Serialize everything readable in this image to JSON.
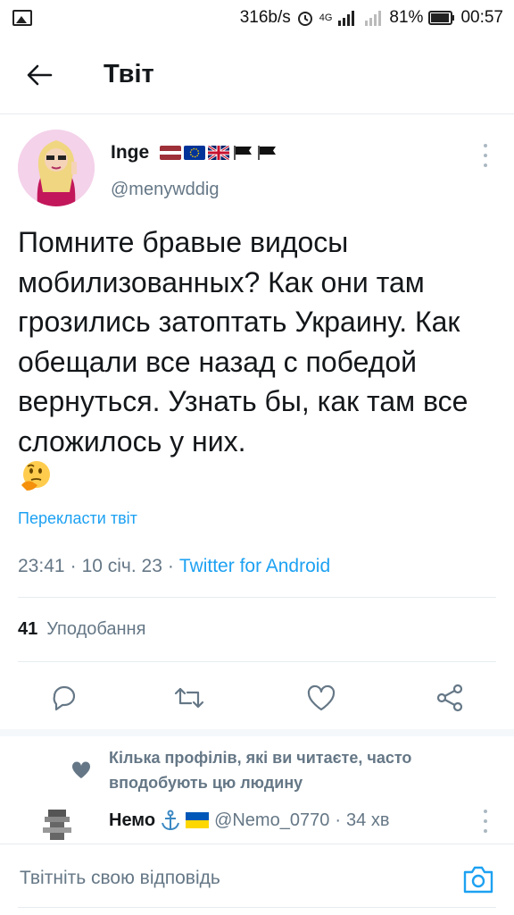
{
  "statusbar": {
    "speed": "316b/s",
    "network": "4G",
    "battery": "81%",
    "time": "00:57"
  },
  "header": {
    "title": "Твіт",
    "back_icon": "arrow-left-icon"
  },
  "tweet": {
    "author_name": "Inge",
    "author_flags": [
      "latvia-flag",
      "eu-flag",
      "uk-flag",
      "black-flag",
      "black-flag"
    ],
    "author_handle": "@menywddig",
    "text": "Помните бравые видосы мобилизованных? Как они там грозились затоптать Украину. Как обещали все назад с победой вернуться. Узнать бы, как там все сложилось у них.",
    "emoji": "thinking-face",
    "translate_label": "Перекласти твіт",
    "time": "23:41",
    "date": "10 січ. 23",
    "client": "Twitter for Android",
    "likes_count": "41",
    "likes_label": "Уподобання"
  },
  "actions": [
    "reply-icon",
    "retweet-icon",
    "like-icon",
    "share-icon"
  ],
  "social_context": {
    "text": "Кілька профілів, які ви читаєте, часто вподобують цю людину"
  },
  "reply": {
    "name": "Немо",
    "badges": [
      "anchor-emoji",
      "ukraine-flag"
    ],
    "handle": "@Nemo_0770",
    "time_ago": "34 хв"
  },
  "composer": {
    "placeholder": "Твітніть свою відповідь"
  },
  "colors": {
    "accent": "#1da1f2",
    "secondary_text": "#657786",
    "divider": "#e6ecf0"
  }
}
